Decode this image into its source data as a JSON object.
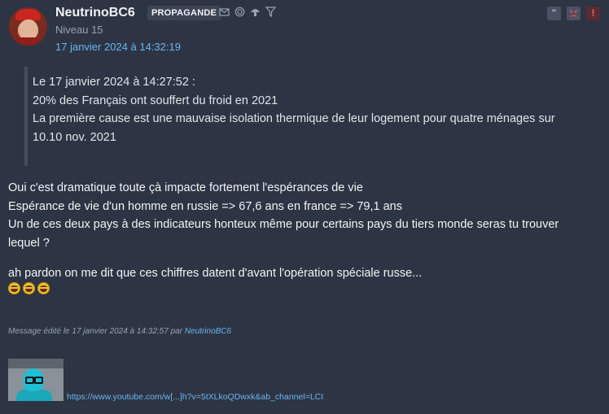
{
  "header": {
    "username": "NeutrinoBC6",
    "badge": "PROPAGANDE",
    "level": "Niveau 15",
    "date": "17 janvier 2024 à 14:32:19",
    "header_icons": [
      "mail-icon",
      "spiral-icon",
      "mushroom-icon",
      "filter-icon"
    ],
    "action_icons": [
      "quote-icon",
      "angry-face-icon",
      "alert-icon"
    ]
  },
  "quote": {
    "line1": "Le 17 janvier 2024 à 14:27:52 :",
    "line2": "20% des Français ont souffert du froid en 2021",
    "line3": "La première cause est une mauvaise isolation thermique de leur logement pour quatre ménages sur",
    "line4": "10.10 nov. 2021"
  },
  "message": {
    "p1": "Oui c'est dramatique toute çà impacte fortement l'espérances de vie",
    "p2": "Espérance de vie d'un homme en russie => 67,6 ans en france => 79,1 ans",
    "p3a": "Un de ces deux pays à des indicateurs honteux même pour certains pays du tiers monde seras tu trouver",
    "p3b": "lequel ?",
    "p4": "ah pardon on me dit que ces chiffres datent d'avant l'opération spéciale russe..."
  },
  "edited": {
    "prefix": "Message édité le 17 janvier 2024 à 14:32:57 par ",
    "by": "NeutrinoBC6"
  },
  "signature": {
    "link": "https://www.youtube.com/w[...]h?v=5tXLkoQDwxk&ab_channel=LCI"
  },
  "colors": {
    "background": "#2d3544",
    "link": "#6cb4f0"
  }
}
